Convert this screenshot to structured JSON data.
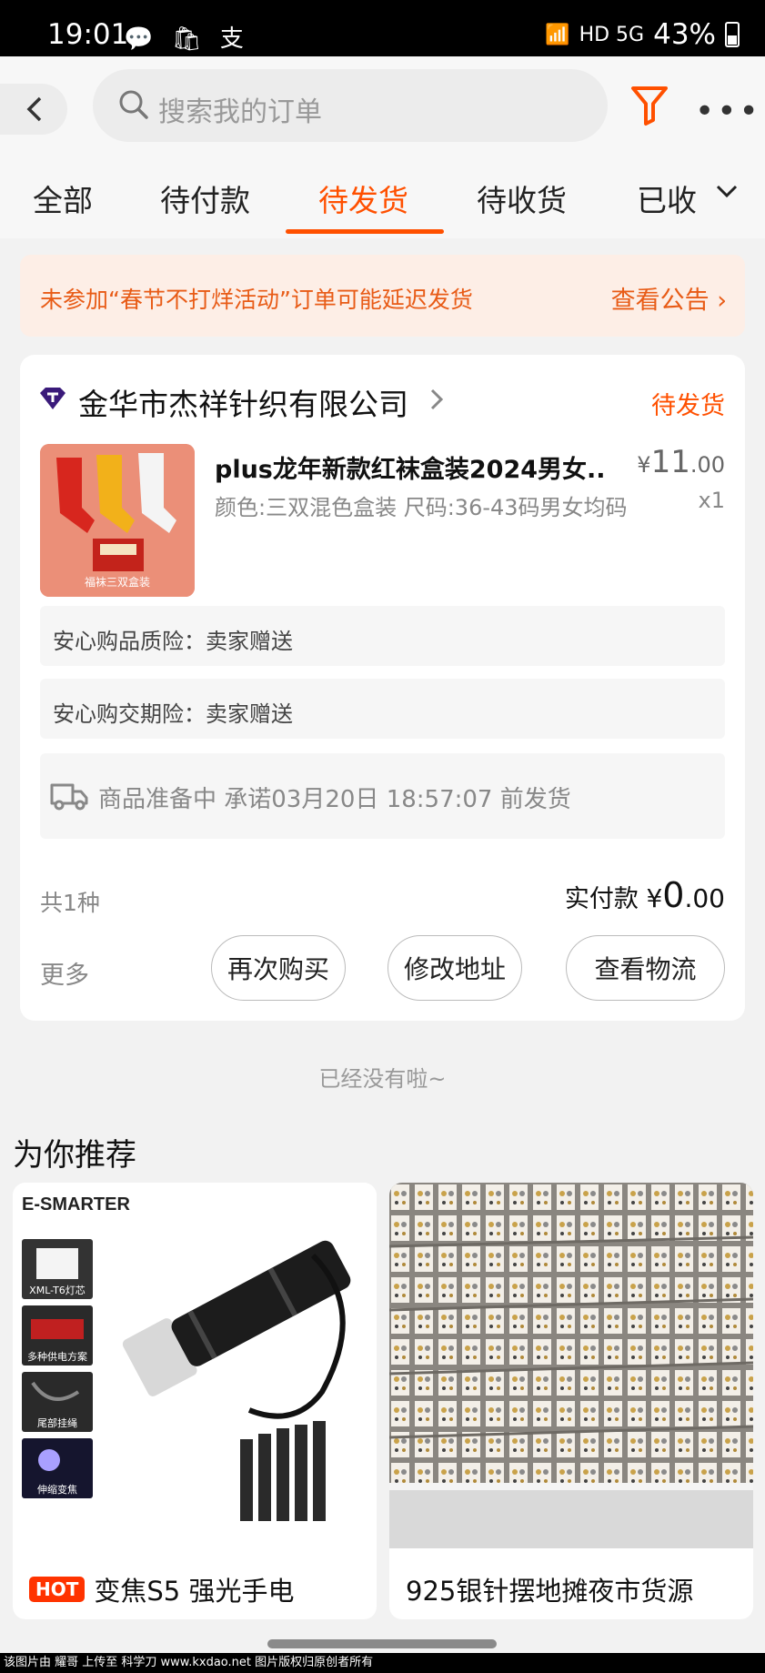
{
  "status_bar": {
    "time": "19:01",
    "app_icons": "💬 🛍 支",
    "network": "HD 5G",
    "battery": "43%"
  },
  "search": {
    "placeholder": "搜索我的订单"
  },
  "tabs": [
    {
      "label": "全部"
    },
    {
      "label": "待付款"
    },
    {
      "label": "待发货",
      "active": true
    },
    {
      "label": "待收货"
    },
    {
      "label": "已收"
    }
  ],
  "notice": {
    "text": "未参加“春节不打烊活动”订单可能延迟发货",
    "link": "查看公告"
  },
  "order": {
    "shop_name": "金华市杰祥针织有限公司",
    "status": "待发货",
    "product": {
      "title": "plus龙年新款红袜盒装2024男女...",
      "spec": "颜色:三双混色盒装 尺码:36-43码男女均码",
      "price_symbol": "¥",
      "price_int": "11",
      "price_dec": ".00",
      "quantity": "x1",
      "thumb_caption": "福袜三双盒装"
    },
    "insurance": [
      "安心购品质险：卖家赠送",
      "安心购交期险：卖家赠送"
    ],
    "shipping_text": "商品准备中 承诺03月20日 18:57:07 前发货",
    "item_count": "共1种",
    "paid_label": "实付款",
    "paid_symbol": "¥",
    "paid_int": "0",
    "paid_dec": ".00",
    "more_label": "更多",
    "buttons": [
      "再次购买",
      "修改地址",
      "查看物流"
    ]
  },
  "end_text": "已经没有啦~",
  "recommend": {
    "title": "为你推荐",
    "items": [
      {
        "badge": "HOT",
        "label": "变焦S5 强光手电",
        "brand": "E-SMARTER",
        "features": [
          "XML-T6灯芯",
          "多种供电方案",
          "尾部挂绳",
          "伸缩变焦"
        ]
      },
      {
        "label": "925银针摆地摊夜市货源"
      }
    ]
  },
  "watermark": "该图片由 耀哥 上传至 科学刀 www.kxdao.net 图片版权归原创者所有"
}
